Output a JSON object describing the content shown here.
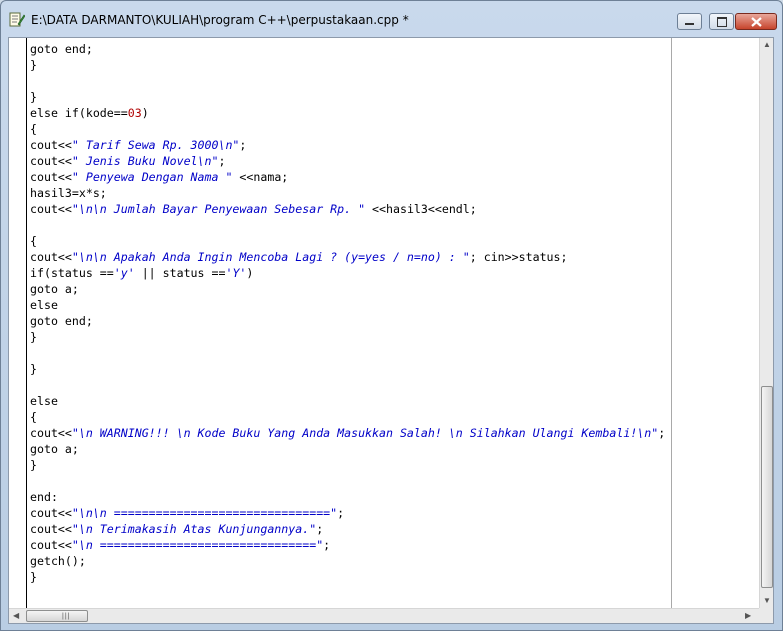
{
  "window": {
    "title": "E:\\DATA DARMANTO\\KULIAH\\program C++\\perpustakaan.cpp *"
  },
  "code_lines": [
    [
      {
        "t": "goto end;",
        "k": "p"
      }
    ],
    [
      {
        "t": "}",
        "k": "p"
      }
    ],
    [
      {
        "t": "",
        "k": "p"
      }
    ],
    [
      {
        "t": "}",
        "k": "p"
      }
    ],
    [
      {
        "t": "else if(kode==",
        "k": "p"
      },
      {
        "t": "03",
        "k": "n"
      },
      {
        "t": ")",
        "k": "p"
      }
    ],
    [
      {
        "t": "{",
        "k": "p"
      }
    ],
    [
      {
        "t": "cout<<",
        "k": "p"
      },
      {
        "t": "\" Tarif Sewa Rp. 3000\\n\"",
        "k": "s"
      },
      {
        "t": ";",
        "k": "p"
      }
    ],
    [
      {
        "t": "cout<<",
        "k": "p"
      },
      {
        "t": "\" Jenis Buku Novel\\n\"",
        "k": "s"
      },
      {
        "t": ";",
        "k": "p"
      }
    ],
    [
      {
        "t": "cout<<",
        "k": "p"
      },
      {
        "t": "\" Penyewa Dengan Nama \"",
        "k": "s"
      },
      {
        "t": " <<nama;",
        "k": "p"
      }
    ],
    [
      {
        "t": "hasil3=x*s;",
        "k": "p"
      }
    ],
    [
      {
        "t": "cout<<",
        "k": "p"
      },
      {
        "t": "\"\\n\\n Jumlah Bayar Penyewaan Sebesar Rp. \"",
        "k": "s"
      },
      {
        "t": " <<hasil3<<endl;",
        "k": "p"
      }
    ],
    [
      {
        "t": "",
        "k": "p"
      }
    ],
    [
      {
        "t": "{",
        "k": "p"
      }
    ],
    [
      {
        "t": "cout<<",
        "k": "p"
      },
      {
        "t": "\"\\n\\n Apakah Anda Ingin Mencoba Lagi ? (y=yes / n=no) : \"",
        "k": "s"
      },
      {
        "t": "; cin>>status;",
        "k": "p"
      }
    ],
    [
      {
        "t": "if(status ==",
        "k": "p"
      },
      {
        "t": "'y'",
        "k": "s"
      },
      {
        "t": " || status ==",
        "k": "p"
      },
      {
        "t": "'Y'",
        "k": "s"
      },
      {
        "t": ")",
        "k": "p"
      }
    ],
    [
      {
        "t": "goto a;",
        "k": "p"
      }
    ],
    [
      {
        "t": "else",
        "k": "p"
      }
    ],
    [
      {
        "t": "goto end;",
        "k": "p"
      }
    ],
    [
      {
        "t": "}",
        "k": "p"
      }
    ],
    [
      {
        "t": "",
        "k": "p"
      }
    ],
    [
      {
        "t": "}",
        "k": "p"
      }
    ],
    [
      {
        "t": "",
        "k": "p"
      }
    ],
    [
      {
        "t": "else",
        "k": "p"
      }
    ],
    [
      {
        "t": "{",
        "k": "p"
      }
    ],
    [
      {
        "t": "cout<<",
        "k": "p"
      },
      {
        "t": "\"\\n WARNING!!! \\n Kode Buku Yang Anda Masukkan Salah! \\n Silahkan Ulangi Kembali!\\n\"",
        "k": "s"
      },
      {
        "t": ";",
        "k": "p"
      }
    ],
    [
      {
        "t": "goto a;",
        "k": "p"
      }
    ],
    [
      {
        "t": "}",
        "k": "p"
      }
    ],
    [
      {
        "t": "",
        "k": "p"
      }
    ],
    [
      {
        "t": "end:",
        "k": "p"
      }
    ],
    [
      {
        "t": "cout<<",
        "k": "p"
      },
      {
        "t": "\"\\n\\n ===============================\"",
        "k": "s"
      },
      {
        "t": ";",
        "k": "p"
      }
    ],
    [
      {
        "t": "cout<<",
        "k": "p"
      },
      {
        "t": "\"\\n Terimakasih Atas Kunjungannya.\"",
        "k": "s"
      },
      {
        "t": ";",
        "k": "p"
      }
    ],
    [
      {
        "t": "cout<<",
        "k": "p"
      },
      {
        "t": "\"\\n ===============================\"",
        "k": "s"
      },
      {
        "t": ";",
        "k": "p"
      }
    ],
    [
      {
        "t": "getch();",
        "k": "p"
      }
    ],
    [
      {
        "t": "}",
        "k": "p"
      }
    ]
  ],
  "colors": {
    "string": "#0000c8",
    "number": "#b00000",
    "plain": "#000000"
  },
  "icons": {
    "app": "document-edit-icon",
    "minimize": "minimize-icon",
    "maximize": "maximize-icon",
    "close": "close-icon"
  }
}
